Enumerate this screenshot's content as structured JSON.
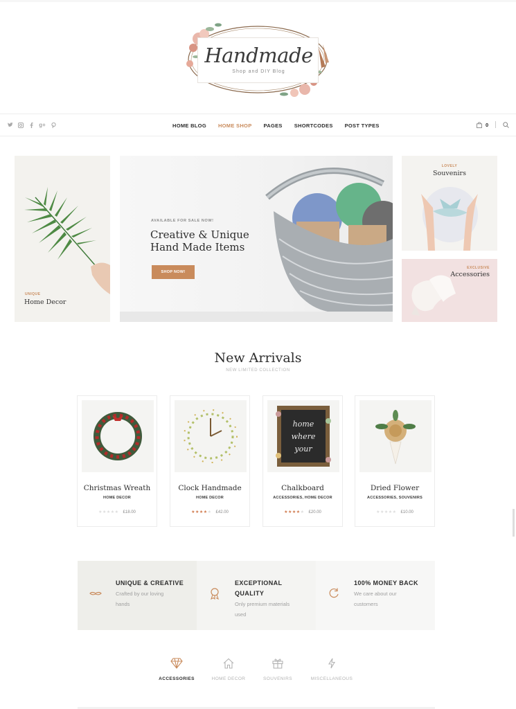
{
  "logo": {
    "title": "Handmade",
    "subtitle": "Shop and DIY Blog"
  },
  "nav": {
    "social": [
      "twitter-icon",
      "instagram-icon",
      "facebook-icon",
      "google-plus-icon",
      "pinterest-icon"
    ],
    "items": [
      "HOME BLOG",
      "HOME SHOP",
      "PAGES",
      "SHORTCODES",
      "POST TYPES"
    ],
    "active": "HOME SHOP",
    "cart_count": "0"
  },
  "hero": {
    "left": {
      "tag": "UNIQUE",
      "title": "Home Decor"
    },
    "center": {
      "tag": "AVAILABLE FOR SALE NOW!",
      "title_line1": "Creative & Unique",
      "title_line2": "Hand Made Items",
      "button": "SHOP NOW!"
    },
    "right_top": {
      "tag": "LOVELY",
      "title": "Souvenirs"
    },
    "right_bottom": {
      "tag": "EXCLUSIVE",
      "title": "Accessories"
    }
  },
  "arrivals": {
    "title": "New Arrivals",
    "subtitle": "NEW LIMITED COLLECTION",
    "products": [
      {
        "name": "Christmas Wreath",
        "category": "HOME DECOR",
        "rating": 0,
        "price": "£18.00"
      },
      {
        "name": "Clock Handmade",
        "category": "HOME DECOR",
        "rating": 4,
        "price": "£42.00"
      },
      {
        "name": "Chalkboard",
        "category": "ACCESSORIES, HOME DECOR",
        "rating": 4,
        "price": "£20.00"
      },
      {
        "name": "Dried Flower",
        "category": "ACCESSORIES, SOUVENIRS",
        "rating": 0,
        "price": "£10.00"
      }
    ],
    "chalkboard_text": [
      "home",
      "where",
      "your"
    ]
  },
  "features": [
    {
      "icon": "mustache-icon",
      "title_line1": "UNIQUE & CREATIVE",
      "title_line2": "",
      "desc_line1": "Crafted by our loving",
      "desc_line2": "hands"
    },
    {
      "icon": "award-ribbon-icon",
      "title_line1": "EXCEPTIONAL",
      "title_line2": "QUALITY",
      "desc_line1": "Only premium materials",
      "desc_line2": "used"
    },
    {
      "icon": "refresh-icon",
      "title_line1": "100% MONEY BACK",
      "title_line2": "",
      "desc_line1": "We care about our",
      "desc_line2": "customers"
    }
  ],
  "tabs": [
    {
      "icon": "diamond-icon",
      "label": "ACCESSORIES"
    },
    {
      "icon": "home-icon",
      "label": "HOME DECOR"
    },
    {
      "icon": "gift-icon",
      "label": "SOUVENIRS"
    },
    {
      "icon": "lightning-icon",
      "label": "MISCELLANEOUS"
    }
  ],
  "colors": {
    "accent": "#c98b5c",
    "feature_bg_1": "#eeeeea",
    "feature_bg_2": "#f4f4f2",
    "feature_bg_3": "#f7f7f6"
  }
}
